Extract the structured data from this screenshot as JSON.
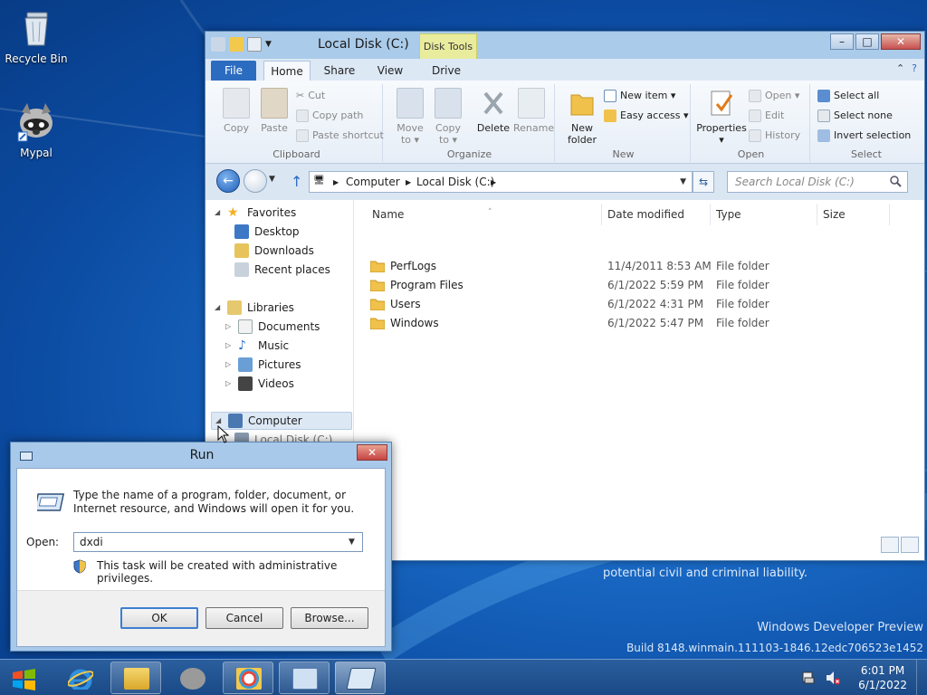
{
  "desktop": {
    "icons": [
      {
        "label": "Recycle Bin"
      },
      {
        "label": "Mypal"
      }
    ],
    "watermark": {
      "liability": "potential civil and criminal liability.",
      "edition": "Windows Developer Preview",
      "build": "Build 8148.winmain.111103-1846.12edc706523e1452"
    }
  },
  "explorer": {
    "title": "Local Disk (C:)",
    "contextual_tab": "Disk Tools",
    "tabs": [
      "File",
      "Home",
      "Share",
      "View",
      "Drive"
    ],
    "ribbon": {
      "clipboard": {
        "label": "Clipboard",
        "copy": "Copy",
        "paste": "Paste",
        "cut": "Cut",
        "copy_path": "Copy path",
        "paste_shortcut": "Paste shortcut"
      },
      "organize": {
        "label": "Organize",
        "move_to": "Move",
        "move_to2": "to ▾",
        "copy_to": "Copy",
        "copy_to2": "to ▾",
        "delete": "Delete",
        "rename": "Rename"
      },
      "new": {
        "label": "New",
        "new_folder": "New",
        "new_folder2": "folder",
        "new_item": "New item ▾",
        "easy_access": "Easy access ▾"
      },
      "open": {
        "label": "Open",
        "properties": "Properties",
        "properties2": "▾",
        "open": "Open ▾",
        "edit": "Edit",
        "history": "History"
      },
      "select": {
        "label": "Select",
        "select_all": "Select all",
        "select_none": "Select none",
        "invert": "Invert selection"
      }
    },
    "address": {
      "crumbs": [
        "Computer",
        "Local Disk (C:)"
      ],
      "search_placeholder": "Search Local Disk (C:)"
    },
    "nav_tree": [
      {
        "label": "Favorites"
      },
      {
        "label": "Desktop"
      },
      {
        "label": "Downloads"
      },
      {
        "label": "Recent places"
      },
      {
        "label": "Libraries"
      },
      {
        "label": "Documents"
      },
      {
        "label": "Music"
      },
      {
        "label": "Pictures"
      },
      {
        "label": "Videos"
      },
      {
        "label": "Computer"
      },
      {
        "label": "Local Disk (C:)"
      }
    ],
    "columns": {
      "name": "Name",
      "date": "Date modified",
      "type": "Type",
      "size": "Size"
    },
    "files": [
      {
        "name": "PerfLogs",
        "date": "11/4/2011 8:53 AM",
        "type": "File folder"
      },
      {
        "name": "Program Files",
        "date": "6/1/2022 5:59 PM",
        "type": "File folder"
      },
      {
        "name": "Users",
        "date": "6/1/2022 4:31 PM",
        "type": "File folder"
      },
      {
        "name": "Windows",
        "date": "6/1/2022 5:47 PM",
        "type": "File folder"
      }
    ]
  },
  "run_dialog": {
    "title": "Run",
    "description": "Type the name of a program, folder, document, or Internet resource, and Windows will open it for you.",
    "open_label": "Open:",
    "open_value": "dxdi",
    "admin_note": "This task will be created with administrative privileges.",
    "ok": "OK",
    "cancel": "Cancel",
    "browse": "Browse..."
  },
  "taskbar": {
    "time": "6:01 PM",
    "date": "6/1/2022",
    "apps": [
      "internet-explorer",
      "file-explorer",
      "mypal",
      "paint",
      "control-panel",
      "run"
    ]
  }
}
